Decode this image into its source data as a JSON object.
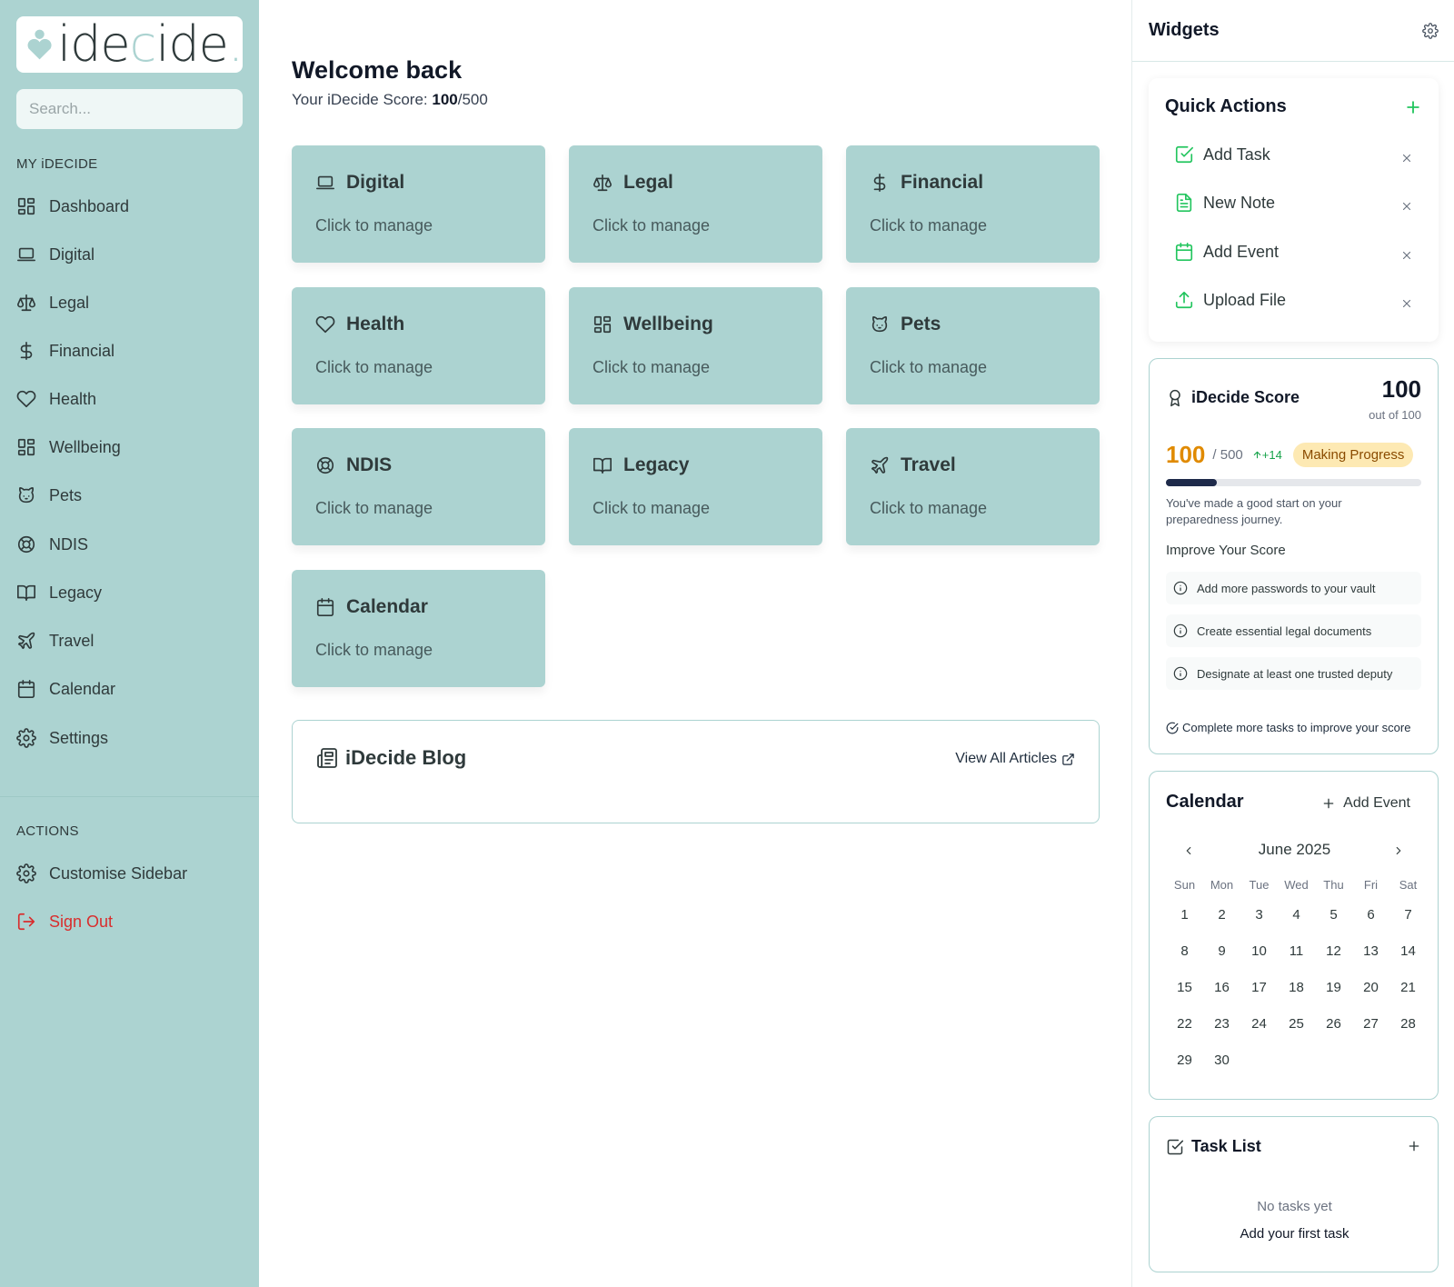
{
  "sidebar": {
    "logo_text_1": "ide",
    "logo_text_2": "c",
    "logo_text_3": "ide",
    "logo_dot": ".",
    "search_placeholder": "Search...",
    "section_my": "MY iDECIDE",
    "items": [
      {
        "label": "Dashboard",
        "icon": "dashboard-icon"
      },
      {
        "label": "Digital",
        "icon": "laptop-icon"
      },
      {
        "label": "Legal",
        "icon": "scale-icon"
      },
      {
        "label": "Financial",
        "icon": "dollar-icon"
      },
      {
        "label": "Health",
        "icon": "heart-icon"
      },
      {
        "label": "Wellbeing",
        "icon": "grid-icon"
      },
      {
        "label": "Pets",
        "icon": "cat-icon"
      },
      {
        "label": "NDIS",
        "icon": "lifebuoy-icon"
      },
      {
        "label": "Legacy",
        "icon": "book-icon"
      },
      {
        "label": "Travel",
        "icon": "plane-icon"
      },
      {
        "label": "Calendar",
        "icon": "calendar-icon"
      },
      {
        "label": "Settings",
        "icon": "gear-icon"
      }
    ],
    "section_actions": "ACTIONS",
    "actions": [
      {
        "label": "Customise Sidebar",
        "icon": "gear-icon"
      },
      {
        "label": "Sign Out",
        "icon": "sign-out-icon",
        "color": "#d92d2d"
      }
    ]
  },
  "main": {
    "welcome": "Welcome back",
    "score_prefix": "Your iDecide Score: ",
    "score_value": "100",
    "score_suffix": "/500",
    "cards": [
      {
        "title": "Digital",
        "sub": "Click to manage",
        "icon": "laptop-icon"
      },
      {
        "title": "Legal",
        "sub": "Click to manage",
        "icon": "scale-icon"
      },
      {
        "title": "Financial",
        "sub": "Click to manage",
        "icon": "dollar-icon"
      },
      {
        "title": "Health",
        "sub": "Click to manage",
        "icon": "heart-icon"
      },
      {
        "title": "Wellbeing",
        "sub": "Click to manage",
        "icon": "grid-icon"
      },
      {
        "title": "Pets",
        "sub": "Click to manage",
        "icon": "cat-icon"
      },
      {
        "title": "NDIS",
        "sub": "Click to manage",
        "icon": "lifebuoy-icon"
      },
      {
        "title": "Legacy",
        "sub": "Click to manage",
        "icon": "book-icon"
      },
      {
        "title": "Travel",
        "sub": "Click to manage",
        "icon": "plane-icon"
      },
      {
        "title": "Calendar",
        "sub": "Click to manage",
        "icon": "calendar-icon"
      }
    ],
    "blog": {
      "title": "iDecide Blog",
      "link": "View All Articles"
    }
  },
  "widgets": {
    "title": "Widgets",
    "quick_actions": {
      "title": "Quick Actions",
      "items": [
        {
          "label": "Add Task",
          "icon": "check-square-icon"
        },
        {
          "label": "New Note",
          "icon": "file-text-icon"
        },
        {
          "label": "Add Event",
          "icon": "calendar-icon"
        },
        {
          "label": "Upload File",
          "icon": "upload-icon"
        }
      ]
    },
    "score": {
      "title": "iDecide Score",
      "big": "100",
      "out_of": "out of 100",
      "value": "100",
      "of_total": "/ 500",
      "delta": "+14",
      "badge": "Making Progress",
      "progress": 0.2,
      "message": "You've made a good start on your preparedness journey.",
      "improve_title": "Improve Your Score",
      "tips": [
        "Add more passwords to your vault",
        "Create essential legal documents",
        "Designate at least one trusted deputy"
      ],
      "footer": "Complete more tasks to improve your score"
    },
    "calendar": {
      "title": "Calendar",
      "add_label": "Add Event",
      "month": "June 2025",
      "dow": [
        "Sun",
        "Mon",
        "Tue",
        "Wed",
        "Thu",
        "Fri",
        "Sat"
      ],
      "days": [
        "1",
        "2",
        "3",
        "4",
        "5",
        "6",
        "7",
        "8",
        "9",
        "10",
        "11",
        "12",
        "13",
        "14",
        "15",
        "16",
        "17",
        "18",
        "19",
        "20",
        "21",
        "22",
        "23",
        "24",
        "25",
        "26",
        "27",
        "28",
        "29",
        "30"
      ]
    },
    "tasks": {
      "title": "Task List",
      "empty": "No tasks yet",
      "add_first": "Add your first task"
    }
  }
}
